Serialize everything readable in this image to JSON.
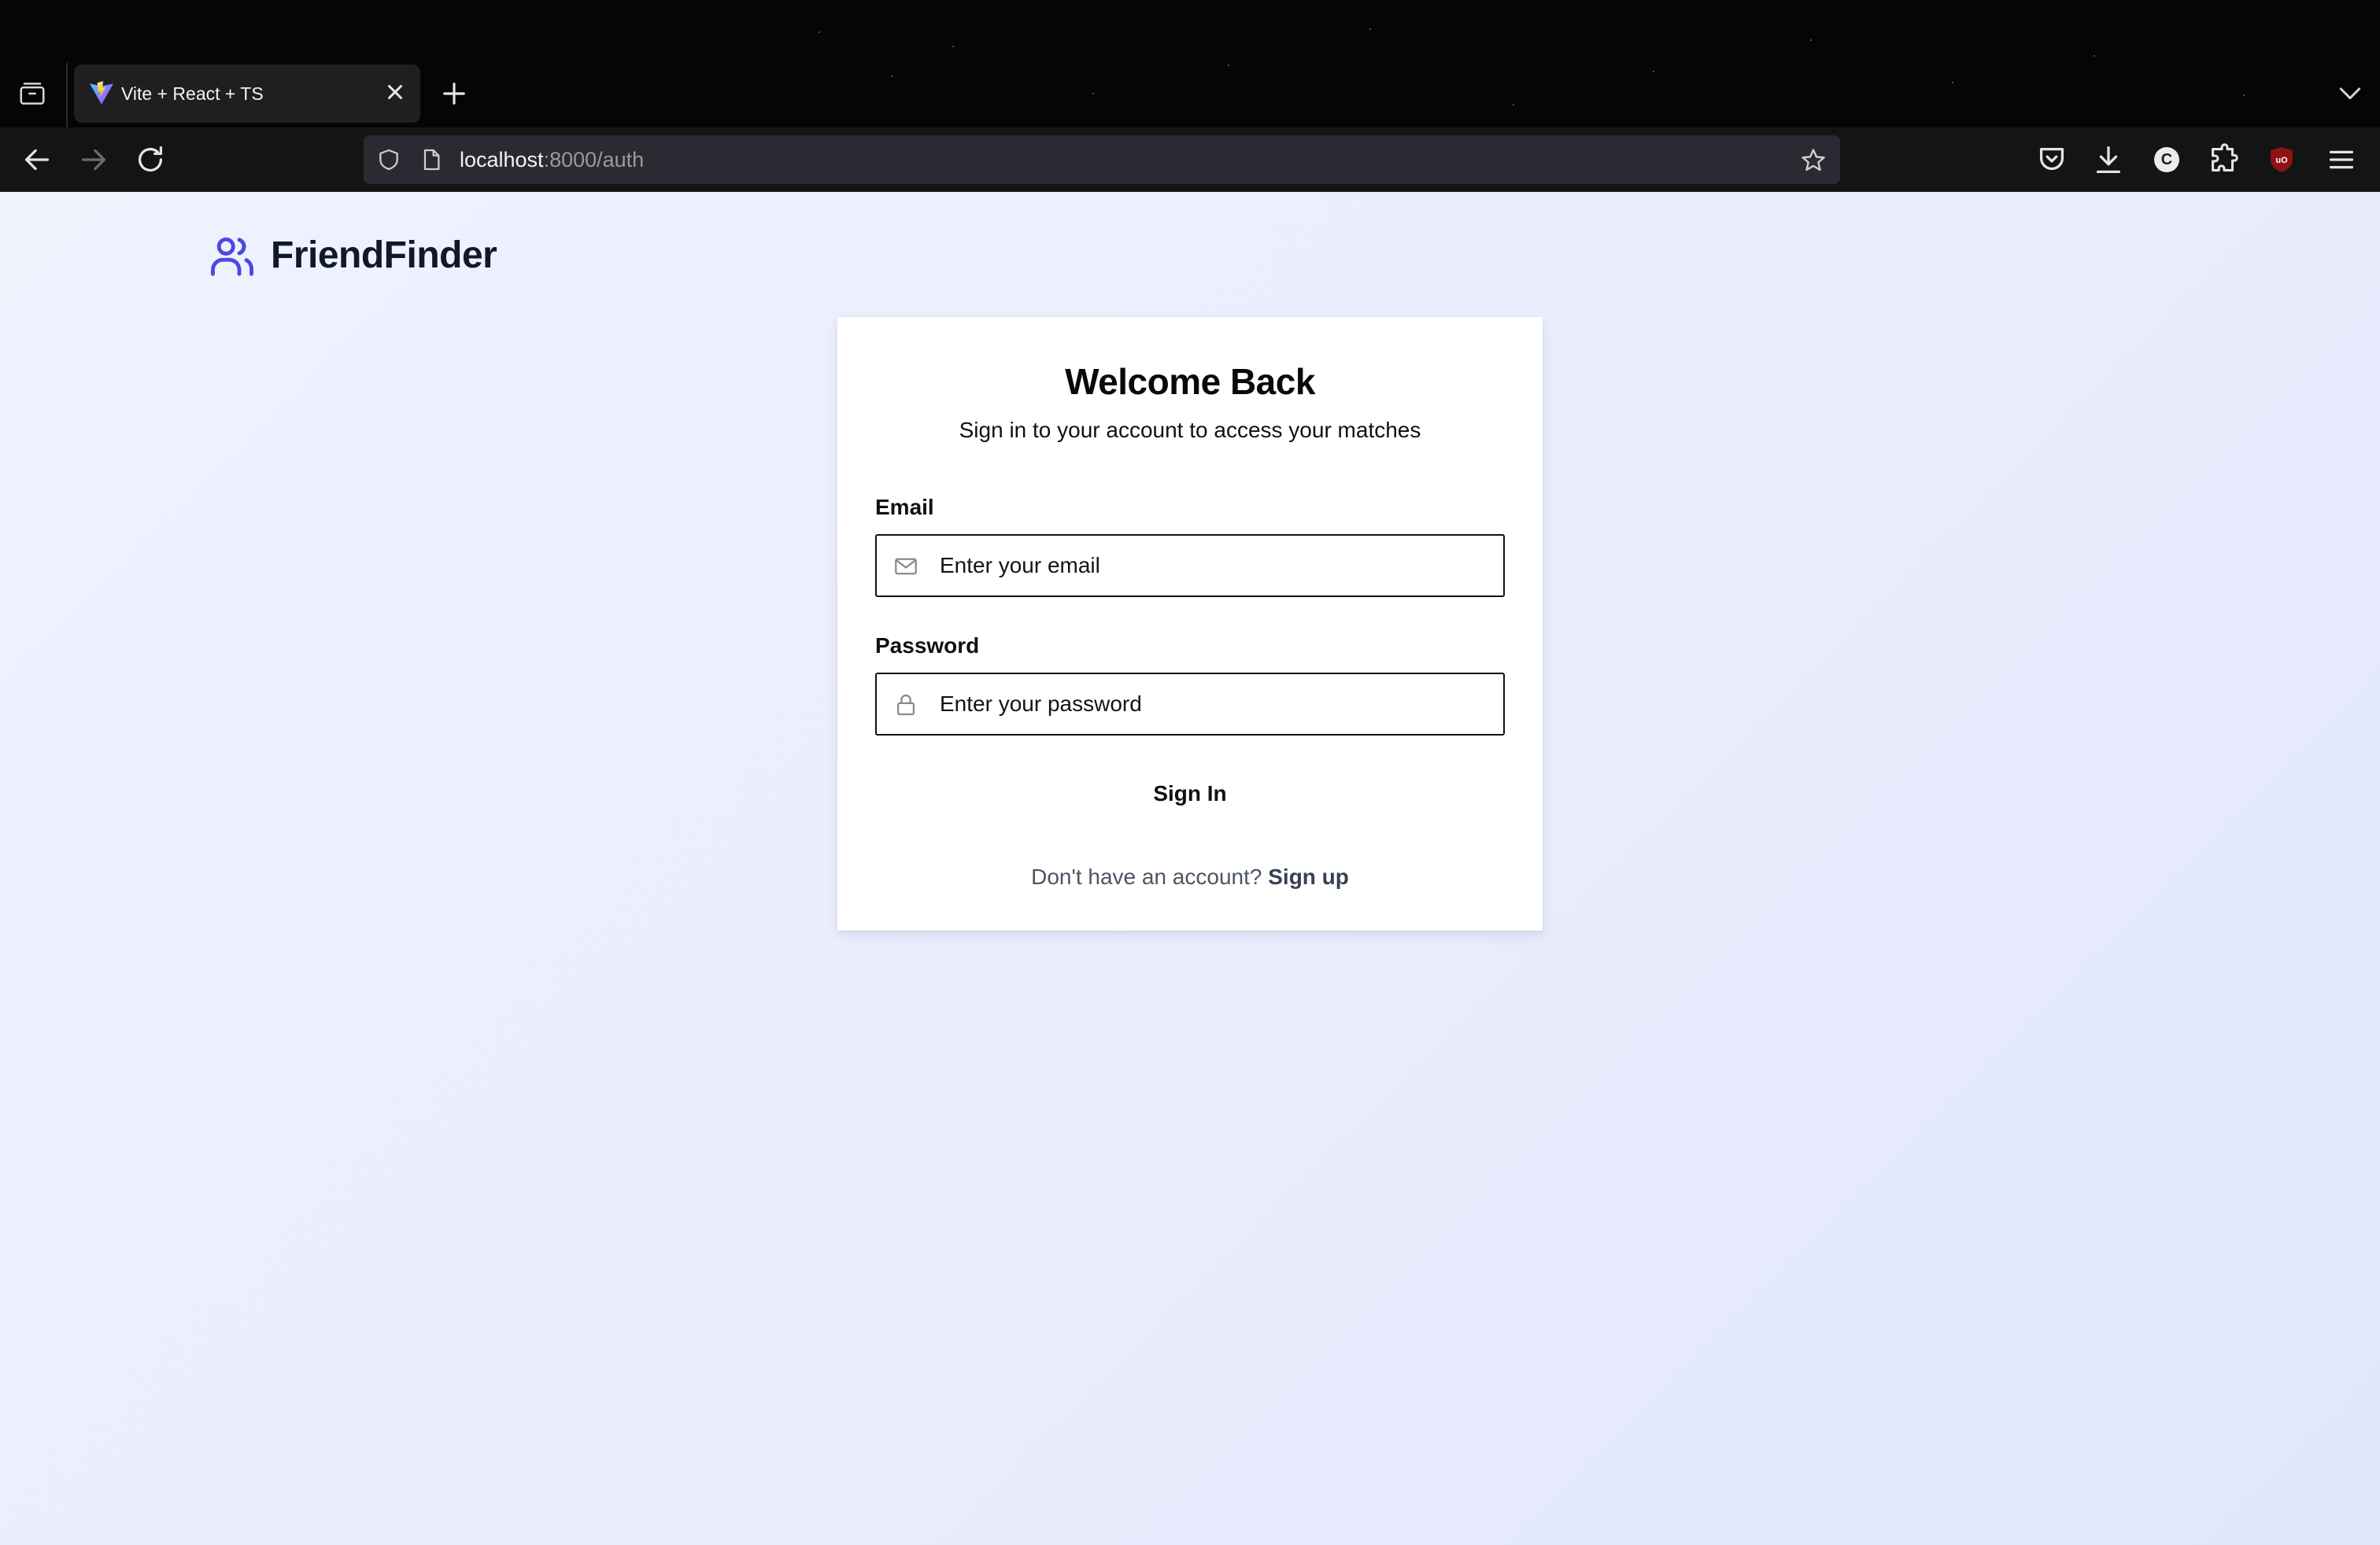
{
  "browser": {
    "tab": {
      "title": "Vite + React + TS"
    },
    "url": {
      "host": "localhost",
      "path": ":8000/auth"
    },
    "icons": {
      "tab_list": "tab-list-icon",
      "close": "close-icon",
      "new_tab": "plus-icon",
      "back": "arrow-left-icon",
      "forward": "arrow-right-icon",
      "reload": "reload-icon",
      "shield": "shield-icon",
      "page": "page-icon",
      "bookmark": "star-icon",
      "pocket": "pocket-icon",
      "downloads": "download-icon",
      "extensions": "puzzle-icon",
      "ublock": "ublock-icon",
      "menu": "hamburger-menu-icon"
    },
    "profile_initial": "C",
    "ublock_label": "uO"
  },
  "app": {
    "brand": "FriendFinder",
    "brand_color": "#4f46e5",
    "login": {
      "title": "Welcome Back",
      "subtitle": "Sign in to your account to access your matches",
      "email_label": "Email",
      "email_placeholder": "Enter your email",
      "email_value": "",
      "password_label": "Password",
      "password_placeholder": "Enter your password",
      "password_value": "",
      "submit_label": "Sign In",
      "footer_prompt": "Don't have an account?",
      "signup_label": "Sign up"
    }
  }
}
